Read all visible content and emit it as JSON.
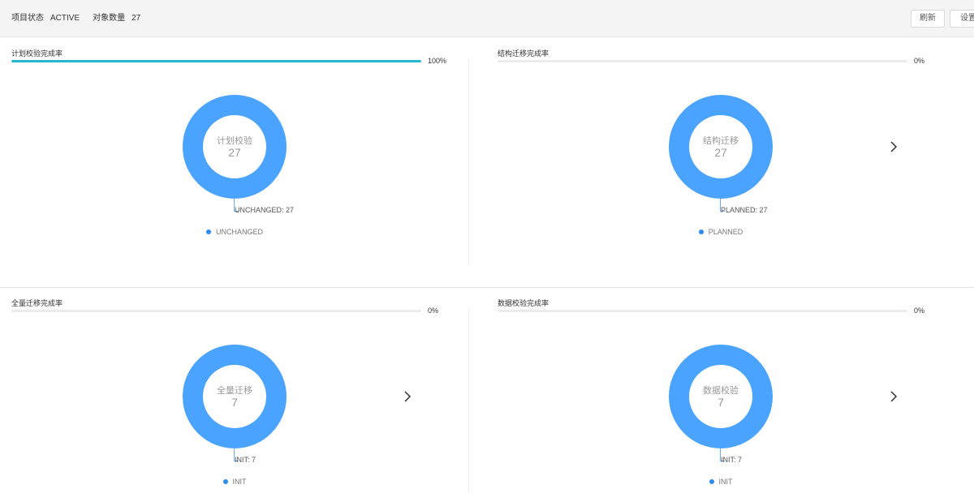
{
  "header": {
    "status_label": "项目状态",
    "status_value": "ACTIVE",
    "count_label": "对象数量",
    "count_value": "27",
    "refresh_label": "刷新",
    "settings_label": "设置"
  },
  "panels": [
    {
      "title": "计划校验完成率",
      "progress": 1.0,
      "progress_text": "100%",
      "center_name": "计划校验",
      "center_count": "27",
      "slice_label": "UNCHANGED: 27",
      "legend": "UNCHANGED",
      "has_arrow": false,
      "arrow_icon": "chevron-right-icon",
      "ring_color": "#4aa3ff"
    },
    {
      "title": "结构迁移完成率",
      "progress": 0,
      "progress_text": "0%",
      "center_name": "结构迁移",
      "center_count": "27",
      "slice_label": "PLANNED: 27",
      "legend": "PLANNED",
      "has_arrow": true,
      "arrow_icon": "chevron-right-icon",
      "ring_color": "#4aa3ff"
    },
    {
      "title": "全量迁移完成率",
      "progress": 0,
      "progress_text": "0%",
      "center_name": "全量迁移",
      "center_count": "7",
      "slice_label": "INIT: 7",
      "legend": "INIT",
      "has_arrow": true,
      "arrow_icon": "chevron-right-icon",
      "ring_color": "#4aa3ff"
    },
    {
      "title": "数据校验完成率",
      "progress": 0,
      "progress_text": "0%",
      "center_name": "数据校验",
      "center_count": "7",
      "slice_label": "INIT: 7",
      "legend": "INIT",
      "has_arrow": true,
      "arrow_icon": "chevron-right-icon",
      "ring_color": "#4aa3ff"
    }
  ],
  "colors": {
    "accent": "#26b8d3",
    "donut": "#4aa3ff",
    "legend_dot": "#2a8cf0"
  }
}
